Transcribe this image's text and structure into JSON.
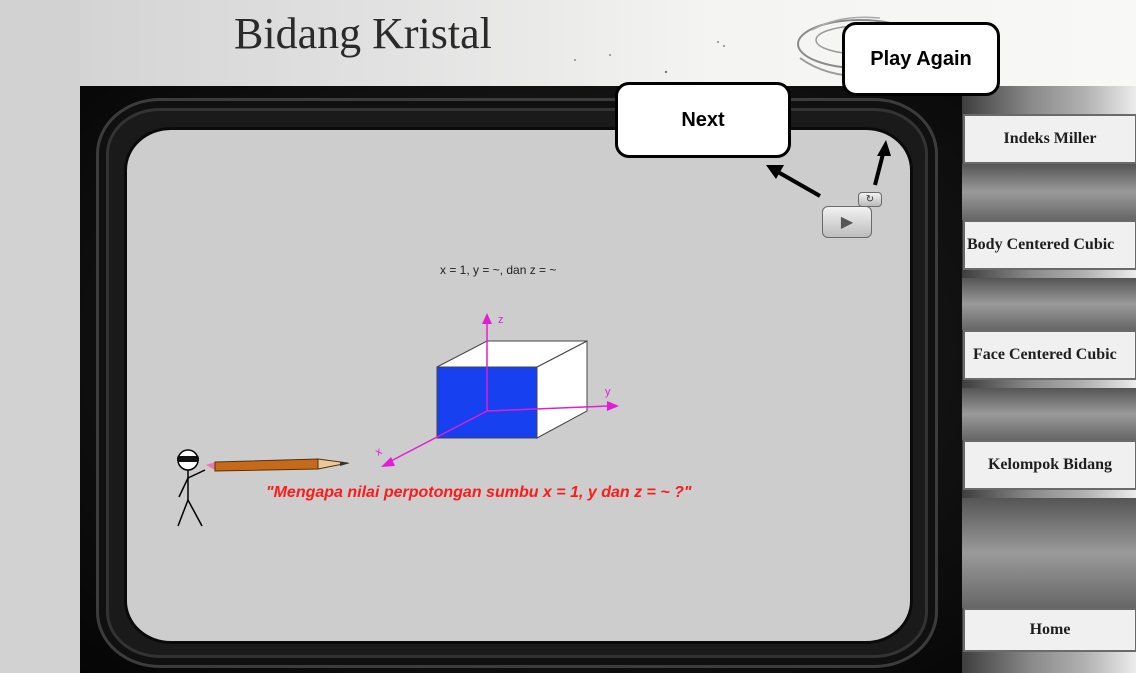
{
  "header": {
    "title": "Bidang Kristal"
  },
  "callouts": {
    "play_again": "Play Again",
    "next": "Next"
  },
  "sidebar": {
    "items": [
      {
        "label": "Indeks Miller"
      },
      {
        "label": "Body Centered Cubic"
      },
      {
        "label": "Face Centered Cubic"
      },
      {
        "label": "Kelompok Bidang"
      },
      {
        "label": "Home"
      }
    ]
  },
  "player": {
    "play_icon": "play-icon",
    "replay_icon": "replay-icon"
  },
  "diagram": {
    "equation": "x = 1, y = ~, dan z = ~",
    "axis_x": "x",
    "axis_y": "y",
    "axis_z": "z",
    "question": "\"Mengapa nilai perpotongan sumbu x = 1, y dan z = ~ ?\""
  },
  "colors": {
    "plane_fill": "#1740f0",
    "axis": "#e01ed6",
    "question_text": "#ff1a1a",
    "screen": "#cdcdcd"
  }
}
